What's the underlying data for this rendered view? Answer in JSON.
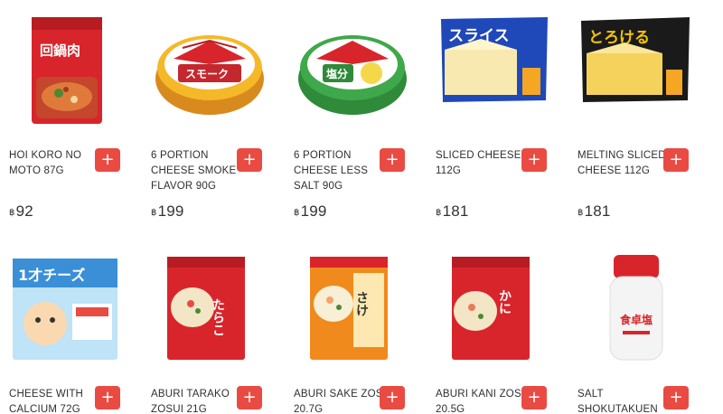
{
  "currency_symbol": "฿",
  "add_button_label": "+",
  "products": [
    {
      "name": "HOI KORO NO MOTO 87G",
      "price": "92",
      "icon": "sauce-pouch-image"
    },
    {
      "name": "6 PORTION CHEESE SMOKE FLAVOR 90G",
      "price": "199",
      "icon": "cheese-box-image"
    },
    {
      "name": "6 PORTION CHEESE LESS SALT 90G",
      "price": "199",
      "icon": "cheese-box-image"
    },
    {
      "name": "SLICED CHEESE 112G",
      "price": "181",
      "icon": "cheese-pack-image"
    },
    {
      "name": "MELTING SLICED CHEESE 112G",
      "price": "181",
      "icon": "cheese-pack-image"
    },
    {
      "name": "CHEESE WITH CALCIUM 72G",
      "price": "",
      "icon": "cheese-pack-image"
    },
    {
      "name": "ABURI TARAKO ZOSUI 21G",
      "price": "",
      "icon": "soup-pouch-image"
    },
    {
      "name": "ABURI SAKE ZOSUI 20.7G",
      "price": "",
      "icon": "soup-pouch-image"
    },
    {
      "name": "ABURI KANI ZOSUI 20.5G",
      "price": "",
      "icon": "soup-pouch-image"
    },
    {
      "name": "SALT SHOKUTAKUEN",
      "price": "",
      "icon": "salt-shaker-image"
    }
  ],
  "product_labels": {
    "p0": "回鍋肉",
    "p1": "スモーク",
    "p2": "塩分",
    "p3": "スライス",
    "p4": "とろける",
    "p5": "1才チーズ",
    "p6": "たらこ",
    "p7": "さけ",
    "p8": "かに",
    "p9": "食卓塩"
  },
  "colors": {
    "accent": "#e94b43",
    "text": "#2f2f2f"
  }
}
